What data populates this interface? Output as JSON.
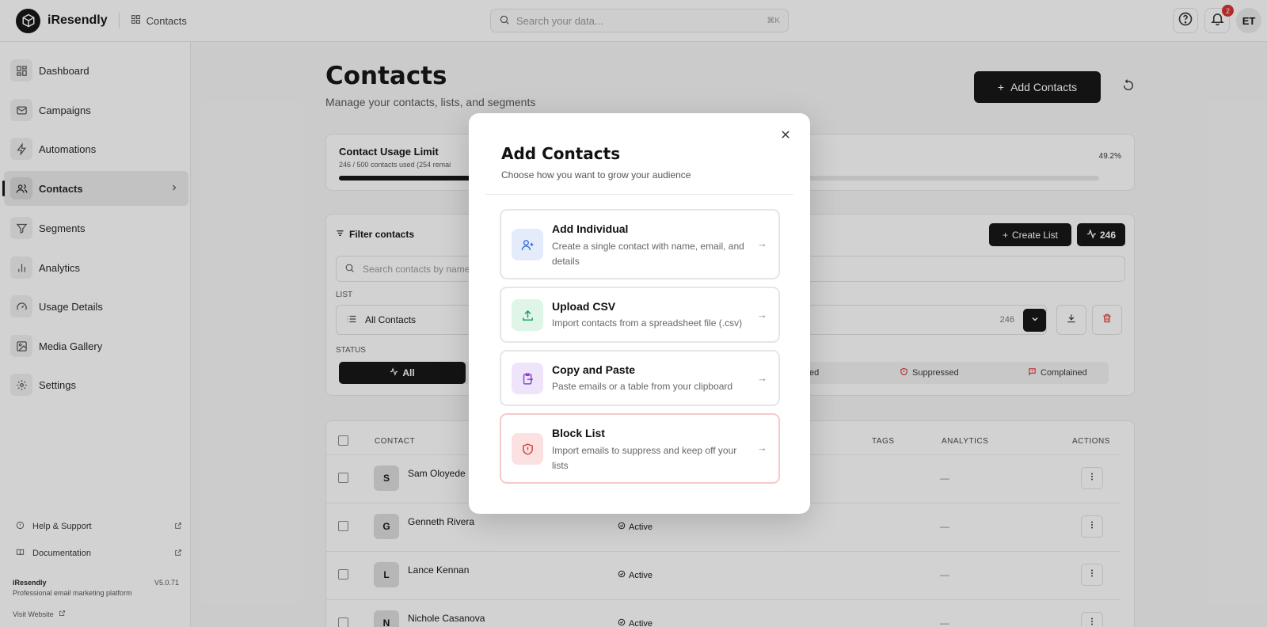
{
  "app": {
    "name": "iResendly",
    "breadcrumb": "Contacts"
  },
  "topbar": {
    "search_placeholder": "Search your data...",
    "search_shortcut": "⌘K",
    "notification_count": "2",
    "avatar_initials": "ET"
  },
  "sidebar": {
    "items": [
      {
        "label": "Dashboard",
        "icon": "grid-icon"
      },
      {
        "label": "Campaigns",
        "icon": "mail-icon"
      },
      {
        "label": "Automations",
        "icon": "bolt-icon"
      },
      {
        "label": "Contacts",
        "icon": "users-icon",
        "active": true
      },
      {
        "label": "Segments",
        "icon": "filter-icon"
      },
      {
        "label": "Analytics",
        "icon": "bar-chart-icon"
      },
      {
        "label": "Usage Details",
        "icon": "gauge-icon"
      },
      {
        "label": "Media Gallery",
        "icon": "image-icon"
      },
      {
        "label": "Settings",
        "icon": "gear-icon"
      }
    ],
    "help": "Help & Support",
    "docs": "Documentation",
    "footer_brand": "iResendly",
    "version": "V5.0.71",
    "tagline": "Professional email marketing platform",
    "visit": "Visit Website"
  },
  "page": {
    "title": "Contacts",
    "subtitle": "Manage your contacts, lists, and segments",
    "add_button": "Add Contacts"
  },
  "usage": {
    "title": "Contact Usage Limit",
    "detail": "246 / 500 contacts used (254 remai",
    "percent_label": "49.2%",
    "fraction": 0.492
  },
  "filters": {
    "heading": "Filter contacts",
    "create_list": "Create List",
    "count": "246",
    "search_placeholder": "Search contacts by name",
    "list_label": "LIST",
    "list_value": "All Contacts",
    "list_count": "246",
    "status_label": "STATUS",
    "status_all": "All",
    "status_partial": "ed",
    "status_suppressed": "Suppressed",
    "status_complained": "Complained"
  },
  "table": {
    "headers": {
      "contact": "CONTACT",
      "tags": "TAGS",
      "analytics": "ANALYTICS",
      "actions": "ACTIONS"
    },
    "rows": [
      {
        "initial": "S",
        "name": "Sam Oloyede",
        "status": "",
        "analytics": "—"
      },
      {
        "initial": "G",
        "name": "Genneth Rivera",
        "status": "Active",
        "analytics": "—"
      },
      {
        "initial": "L",
        "name": "Lance Kennan",
        "status": "Active",
        "analytics": "—"
      },
      {
        "initial": "N",
        "name": "Nichole Casanova",
        "status": "Active",
        "analytics": "—"
      }
    ]
  },
  "modal": {
    "title": "Add Contacts",
    "subtitle": "Choose how you want to grow your audience",
    "options": [
      {
        "title": "Add Individual",
        "desc": "Create a single contact with name, email, and details",
        "icon": "user-plus-icon",
        "color": "#3b6fd8",
        "bg": "#e4ecfb"
      },
      {
        "title": "Upload CSV",
        "desc": "Import contacts from a spreadsheet file (.csv)",
        "icon": "upload-icon",
        "color": "#1e9b57",
        "bg": "#dff5e8"
      },
      {
        "title": "Copy and Paste",
        "desc": "Paste emails or a table from your clipboard",
        "icon": "clipboard-icon",
        "color": "#8a45d6",
        "bg": "#efe5fb"
      },
      {
        "title": "Block List",
        "desc": "Import emails to suppress and keep off your lists",
        "icon": "shield-alert-icon",
        "color": "#d63b3b",
        "bg": "#fbe1e1"
      }
    ]
  }
}
